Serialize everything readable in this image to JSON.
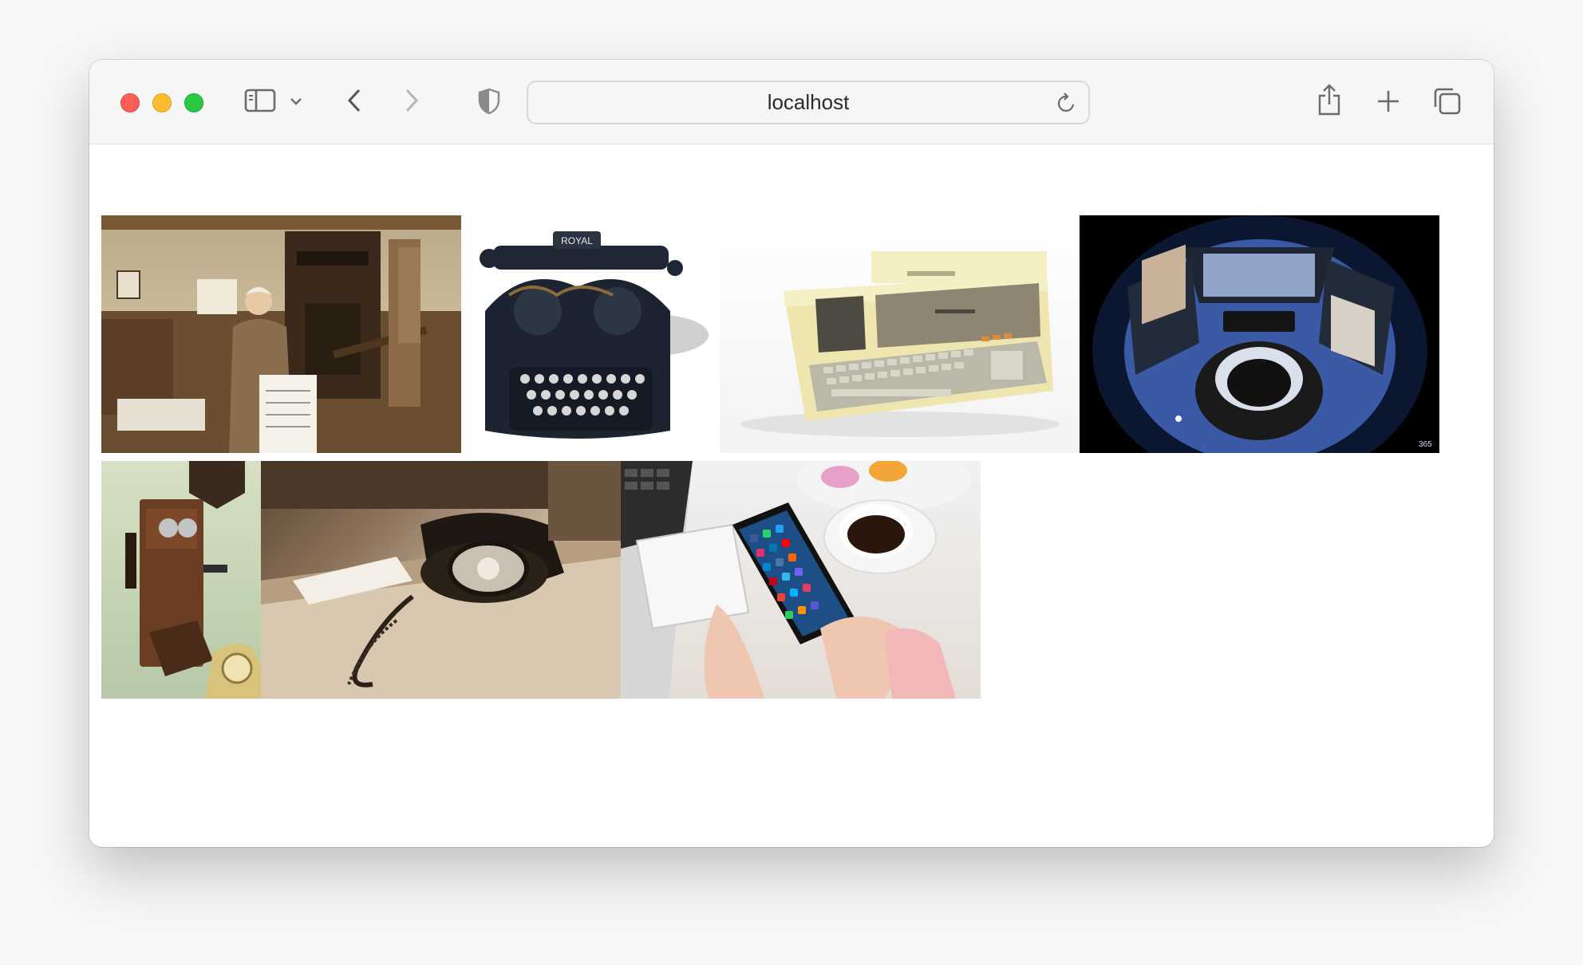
{
  "browser": {
    "address_bar": {
      "url": "localhost"
    },
    "icons": {
      "sidebar": "sidebar-icon",
      "sidebar_menu": "chevron-down-icon",
      "back": "chevron-left-icon",
      "forward": "chevron-right-icon",
      "privacy": "shield-icon",
      "reload": "reload-icon",
      "share": "share-icon",
      "new_tab": "plus-icon",
      "tab_overview": "tabs-icon"
    }
  },
  "gallery": {
    "images": [
      {
        "subject": "printing-press"
      },
      {
        "subject": "typewriter"
      },
      {
        "subject": "vintage-computer"
      },
      {
        "subject": "multi-monitor-setup"
      },
      {
        "subject": "wall-telephone"
      },
      {
        "subject": "rotary-telephone"
      },
      {
        "subject": "smartphone"
      }
    ]
  }
}
